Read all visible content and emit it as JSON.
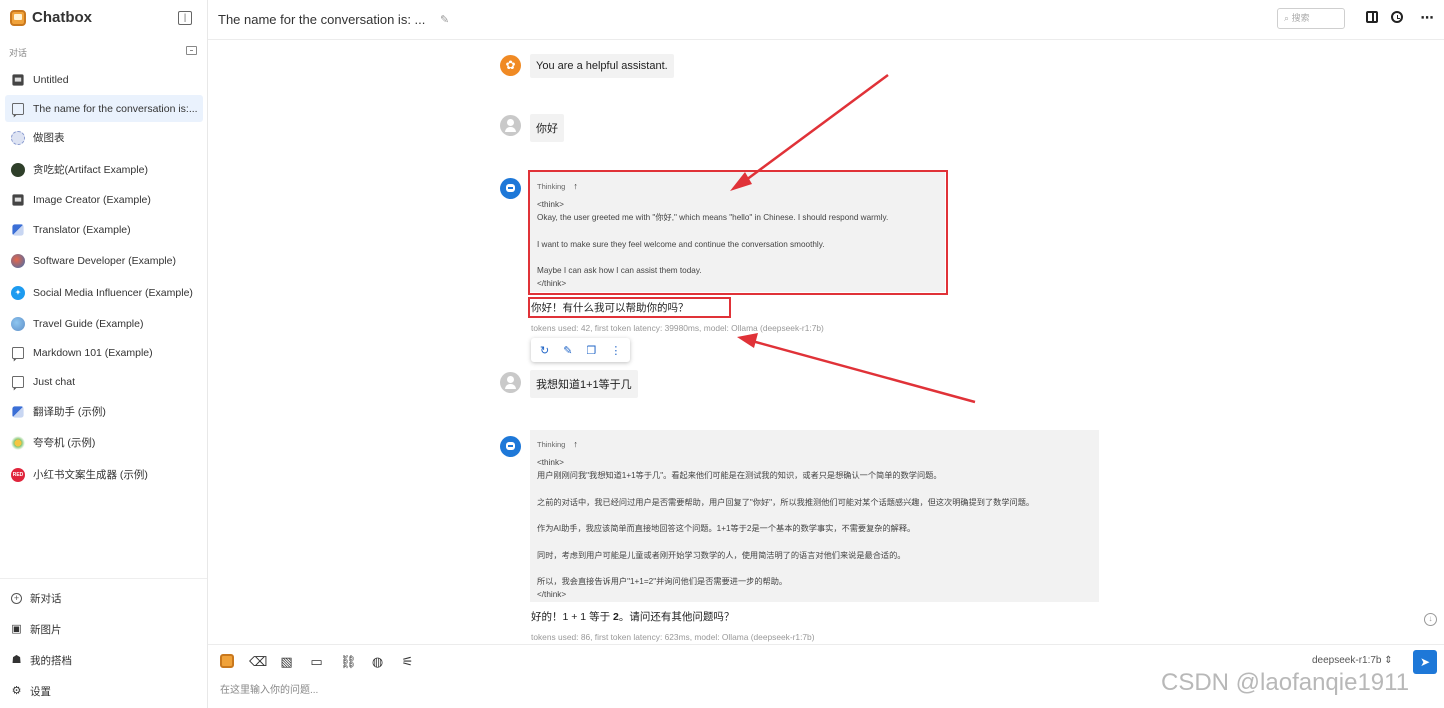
{
  "app": {
    "name": "Chatbox"
  },
  "sidebar": {
    "section_label": "对话",
    "conversations": [
      {
        "label": "Untitled",
        "icon": "image-icon"
      },
      {
        "label": "The name for the conversation is:...",
        "icon": "chat-icon"
      },
      {
        "label": "做图表",
        "icon": "chart-avatar-icon"
      },
      {
        "label": "贪吃蛇(Artifact Example)",
        "icon": "snake-avatar-icon"
      },
      {
        "label": "Image Creator (Example)",
        "icon": "image-icon"
      },
      {
        "label": "Translator (Example)",
        "icon": "translator-avatar-icon"
      },
      {
        "label": "Software Developer (Example)",
        "icon": "developer-avatar-icon"
      },
      {
        "label": "Social Media Influencer (Example)",
        "icon": "twitter-icon"
      },
      {
        "label": "Travel Guide (Example)",
        "icon": "globe-avatar-icon"
      },
      {
        "label": "Markdown 101 (Example)",
        "icon": "chat-icon"
      },
      {
        "label": "Just chat",
        "icon": "chat-icon"
      },
      {
        "label": "翻译助手 (示例)",
        "icon": "translator-avatar-icon"
      },
      {
        "label": "夸夸机 (示例)",
        "icon": "praise-avatar-icon"
      },
      {
        "label": "小红书文案生成器 (示例)",
        "icon": "xiaohongshu-icon"
      }
    ],
    "menu": {
      "new_chat": "新对话",
      "new_image": "新图片",
      "my_partners": "我的搭档",
      "settings": "设置"
    }
  },
  "header": {
    "title": "The name for the conversation is: ...",
    "search_placeholder": "搜索"
  },
  "messages": {
    "system": "You are a helpful assistant.",
    "user1": "你好",
    "bot1": {
      "thinking_label": "Thinking",
      "think_lines": [
        "<think>",
        "Okay, the user greeted me with \"你好,\" which means \"hello\" in Chinese. I should respond warmly.",
        "",
        "I want to make sure they feel welcome and continue the conversation smoothly.",
        "",
        "Maybe I can ask how I can assist them today.",
        "</think>"
      ],
      "answer": "你好！有什么我可以帮助你的吗？",
      "meta": "tokens used: 42, first token latency: 39980ms, model: Ollama (deepseek-r1:7b)"
    },
    "user2": "我想知道1+1等于几",
    "bot2": {
      "thinking_label": "Thinking",
      "think_lines": [
        "<think>",
        "用户刚刚问我\"我想知道1+1等于几\"。看起来他们可能是在测试我的知识，或者只是想确认一个简单的数学问题。",
        "",
        "之前的对话中，我已经问过用户是否需要帮助，用户回复了\"你好\"，所以我推测他们可能对某个话题感兴趣，但这次明确提到了数学问题。",
        "",
        "作为AI助手，我应该简单而直接地回答这个问题。1+1等于2是一个基本的数学事实，不需要复杂的解释。",
        "",
        "同时，考虑到用户可能是儿童或者刚开始学习数学的人，使用简洁明了的语言对他们来说是最合适的。",
        "",
        "所以，我会直接告诉用户\"1+1=2\"并询问他们是否需要进一步的帮助。",
        "</think>"
      ],
      "answer_prefix": "好的！1 + 1 等于 ",
      "answer_bold": "2",
      "answer_suffix": "。请问还有其他问题吗？",
      "meta": "tokens used: 86, first token latency: 623ms, model: Ollama (deepseek-r1:7b)"
    }
  },
  "input": {
    "placeholder": "在这里输入你的问题...",
    "model": "deepseek-r1:7b"
  },
  "watermark": "CSDN @laofanqie1911",
  "colors": {
    "accent": "#1e78d8",
    "annotation": "#e03238"
  }
}
